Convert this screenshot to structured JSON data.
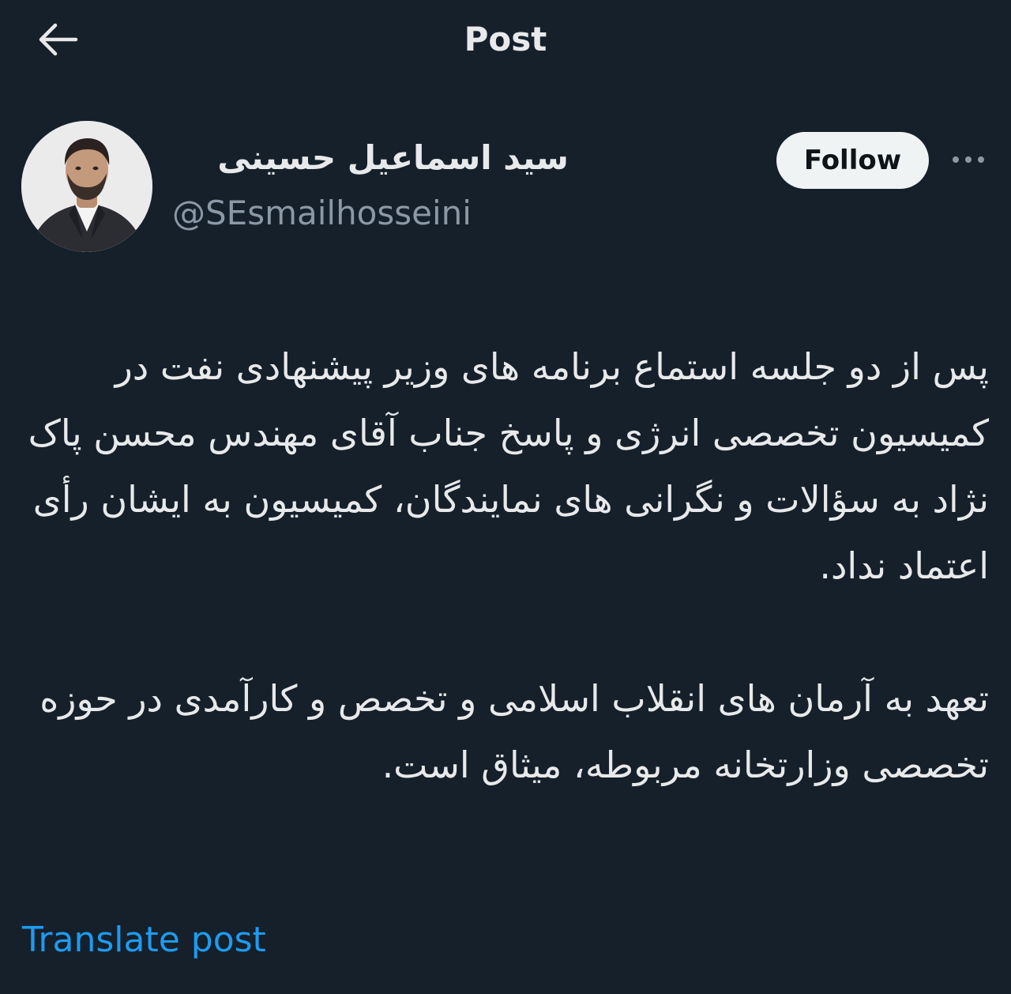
{
  "header": {
    "title": "Post",
    "back_icon": "arrow-left-icon"
  },
  "author": {
    "display_name": "سید اسماعیل حسینی",
    "handle": "@SEsmailhosseini",
    "avatar_icon": "profile-photo"
  },
  "actions": {
    "follow_label": "Follow",
    "more_icon": "more-horizontal-icon"
  },
  "post": {
    "paragraph_1": "پس از دو جلسه استماع برنامه های وزیر پیشنهادی نفت در کمیسیون تخصصی انرژی و پاسخ جناب آقای مهندس محسن پاک نژاد به سؤالات و نگرانی های نمایندگان، کمیسیون به ایشان رأی اعتماد نداد.",
    "paragraph_2": "تعهد به آرمان های انقلاب اسلامی و تخصص و کارآمدی در حوزه تخصصی وزارتخانه مربوطه، میثاق است."
  },
  "translate": {
    "label": "Translate post"
  },
  "colors": {
    "background": "#15202b",
    "text_primary": "#e7e9ea",
    "text_secondary": "#8b98a5",
    "link": "#1d9bf0",
    "follow_bg": "#eff3f4"
  }
}
